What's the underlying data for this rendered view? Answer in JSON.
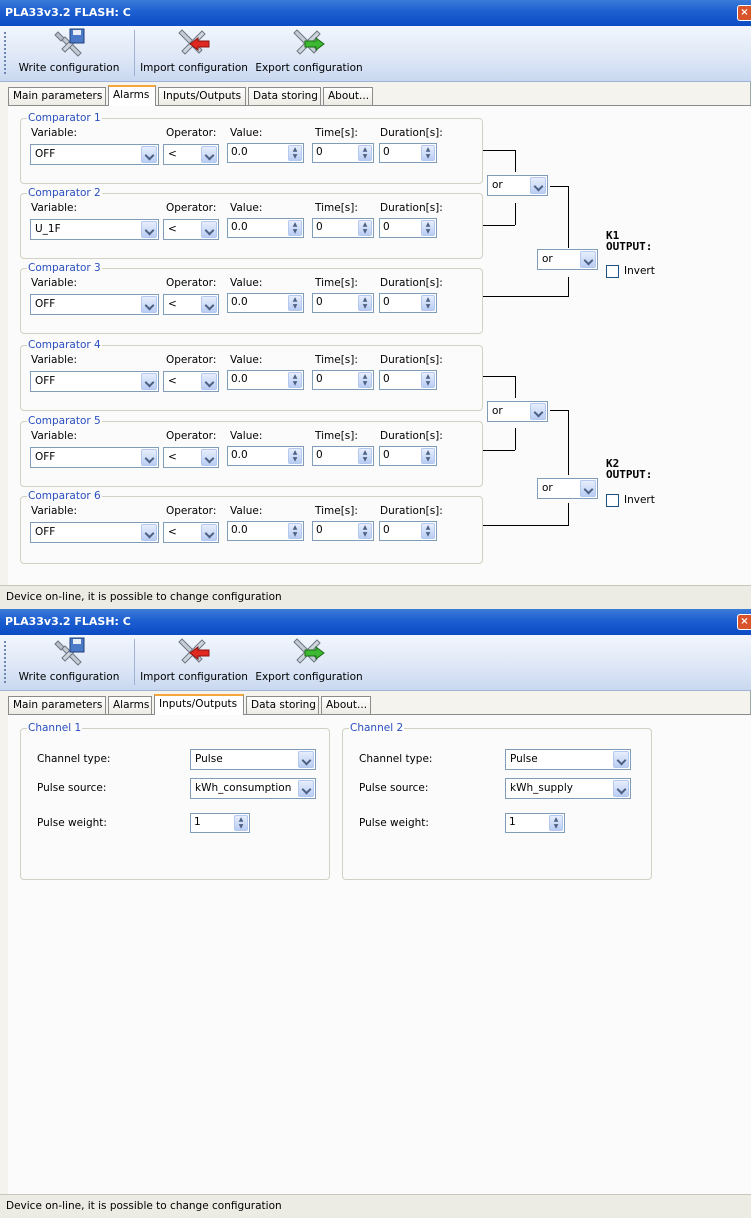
{
  "windows": [
    {
      "title": "PLA33v3.2 FLASH: C",
      "toolbar": {
        "write": "Write configuration",
        "import": "Import configuration",
        "export": "Export configuration"
      },
      "tabs": [
        "Main parameters",
        "Alarms",
        "Inputs/Outputs",
        "Data storing",
        "About..."
      ],
      "active_tab": "Alarms",
      "status": "Device on-line, it is possible to change configuration"
    },
    {
      "title": "PLA33v3.2 FLASH: C",
      "toolbar": {
        "write": "Write configuration",
        "import": "Import configuration",
        "export": "Export configuration"
      },
      "tabs": [
        "Main parameters",
        "Alarms",
        "Inputs/Outputs",
        "Data storing",
        "About..."
      ],
      "active_tab": "Inputs/Outputs",
      "status": "Device on-line, it is possible to change configuration"
    }
  ],
  "alarms": {
    "headers": {
      "variable": "Variable:",
      "operator": "Operator:",
      "value": "Value:",
      "time": "Time[s]:",
      "duration": "Duration[s]:"
    },
    "comparators": [
      {
        "title": "Comparator 1",
        "variable": "OFF",
        "operator": "<",
        "value": "0.0",
        "time": "0",
        "duration": "0"
      },
      {
        "title": "Comparator 2",
        "variable": "U_1F",
        "operator": "<",
        "value": "0.0",
        "time": "0",
        "duration": "0"
      },
      {
        "title": "Comparator 3",
        "variable": "OFF",
        "operator": "<",
        "value": "0.0",
        "time": "0",
        "duration": "0"
      },
      {
        "title": "Comparator 4",
        "variable": "OFF",
        "operator": "<",
        "value": "0.0",
        "time": "0",
        "duration": "0"
      },
      {
        "title": "Comparator 5",
        "variable": "OFF",
        "operator": "<",
        "value": "0.0",
        "time": "0",
        "duration": "0"
      },
      {
        "title": "Comparator 6",
        "variable": "OFF",
        "operator": "<",
        "value": "0.0",
        "time": "0",
        "duration": "0"
      }
    ],
    "logic": [
      {
        "gate1": "or",
        "gate2": "or",
        "out_name": "K1",
        "out_label": "OUTPUT:",
        "invert_label": "Invert",
        "invert_checked": false
      },
      {
        "gate1": "or",
        "gate2": "or",
        "out_name": "K2",
        "out_label": "OUTPUT:",
        "invert_label": "Invert",
        "invert_checked": false
      }
    ]
  },
  "io": {
    "channels": [
      {
        "title": "Channel 1",
        "type_label": "Channel type:",
        "type": "Pulse",
        "source_label": "Pulse source:",
        "source": "kWh_consumption",
        "weight_label": "Pulse weight:",
        "weight": "1"
      },
      {
        "title": "Channel 2",
        "type_label": "Channel type:",
        "type": "Pulse",
        "source_label": "Pulse source:",
        "source": "kWh_supply",
        "weight_label": "Pulse weight:",
        "weight": "1"
      }
    ]
  }
}
